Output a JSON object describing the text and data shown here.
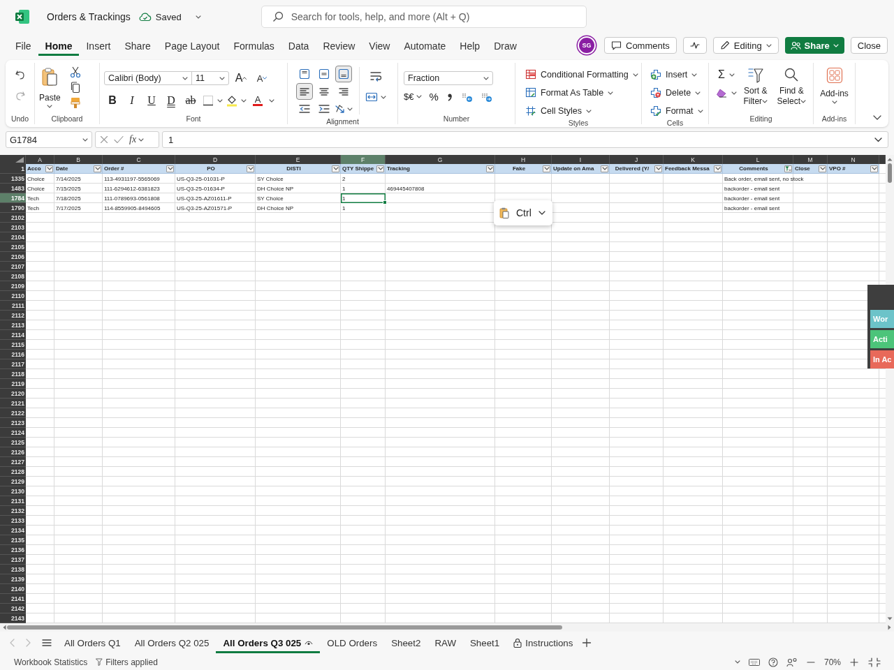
{
  "window": {
    "title": "Orders & Trackings",
    "save_status": "Saved"
  },
  "search": {
    "placeholder": "Search for tools, help, and more (Alt + Q)"
  },
  "menu_tabs": [
    {
      "label": "File",
      "selected": false
    },
    {
      "label": "Home",
      "selected": true
    },
    {
      "label": "Insert",
      "selected": false
    },
    {
      "label": "Share",
      "selected": false
    },
    {
      "label": "Page Layout",
      "selected": false
    },
    {
      "label": "Formulas",
      "selected": false
    },
    {
      "label": "Data",
      "selected": false
    },
    {
      "label": "Review",
      "selected": false
    },
    {
      "label": "View",
      "selected": false
    },
    {
      "label": "Automate",
      "selected": false
    },
    {
      "label": "Help",
      "selected": false
    },
    {
      "label": "Draw",
      "selected": false
    }
  ],
  "account": {
    "initials": "SG"
  },
  "actions": {
    "comments": "Comments",
    "mode": "Editing",
    "share": "Share",
    "close": "Close"
  },
  "ribbon": {
    "undo": {
      "label": "Undo"
    },
    "clipboard": {
      "label": "Clipboard",
      "paste": "Paste"
    },
    "font": {
      "label": "Font",
      "family": "Calibri (Body)",
      "size": "11",
      "grow": "A",
      "shrink": "A",
      "color_label": "A",
      "styles": [
        {
          "kind": "bold",
          "label": "B"
        },
        {
          "kind": "italic",
          "label": "I"
        },
        {
          "kind": "underline",
          "label": "U"
        },
        {
          "kind": "double_underline",
          "label": "D"
        },
        {
          "kind": "strikethrough",
          "label": "ab"
        }
      ]
    },
    "alignment": {
      "label": "Alignment",
      "vertical": [
        {
          "selected": false
        },
        {
          "selected": false
        },
        {
          "selected": true
        }
      ],
      "horizontal": [
        {
          "selected": true
        },
        {
          "selected": false
        },
        {
          "selected": false
        }
      ]
    },
    "number": {
      "label": "Number",
      "format": "Fraction",
      "currency": "$€",
      "percent": "%"
    },
    "styles": {
      "label": "Styles",
      "items": [
        "Conditional Formatting",
        "Format As Table",
        "Cell Styles"
      ]
    },
    "cells": {
      "label": "Cells",
      "items": [
        "Insert",
        "Delete",
        "Format"
      ]
    },
    "editing": {
      "label": "Editing",
      "sum": "Σ",
      "sort": "Sort & Filter",
      "find": "Find & Select"
    },
    "addins": {
      "label": "Add-ins",
      "button": "Add-ins"
    }
  },
  "formula_bar": {
    "name_box": "G1784",
    "function_label": "fx",
    "formula": "1"
  },
  "grid": {
    "columns": [
      {
        "letter": "A",
        "selected": false
      },
      {
        "letter": "B",
        "selected": false
      },
      {
        "letter": "C",
        "selected": false
      },
      {
        "letter": "D",
        "selected": false
      },
      {
        "letter": "E",
        "selected": false
      },
      {
        "letter": "F",
        "selected": true
      },
      {
        "letter": "G",
        "selected": false
      },
      {
        "letter": "H",
        "selected": false
      },
      {
        "letter": "I",
        "selected": false
      },
      {
        "letter": "J",
        "selected": false
      },
      {
        "letter": "K",
        "selected": false
      },
      {
        "letter": "L",
        "selected": false
      },
      {
        "letter": "M",
        "selected": false
      },
      {
        "letter": "N",
        "selected": false
      }
    ],
    "header_row": {
      "number": "1",
      "cells": [
        {
          "label": "Acco",
          "filtered": false
        },
        {
          "label": "Date",
          "filtered": false
        },
        {
          "label": "Order #",
          "filtered": false
        },
        {
          "label": "PO",
          "filtered": false
        },
        {
          "label": "DISTI",
          "filtered": false
        },
        {
          "label": "QTY Shippe",
          "filtered": false
        },
        {
          "label": "Tracking",
          "filtered": false
        },
        {
          "label": "Fake",
          "filtered": false
        },
        {
          "label": "Update on Ama",
          "filtered": false
        },
        {
          "label": "Delivered (Y/",
          "filtered": false
        },
        {
          "label": "Feedback Messa",
          "filtered": false
        },
        {
          "label": "Comments",
          "filtered": true
        },
        {
          "label": "Close",
          "filtered": false
        },
        {
          "label": "VPO #",
          "filtered": false
        }
      ]
    },
    "rows": [
      {
        "number": "1335",
        "selected": false,
        "cells": {
          "A": "Choice",
          "B": "7/14/2025",
          "C": "113-4931197-5565069",
          "D": "US-Q3-25-01031-P",
          "E": "SY Choice",
          "F": "2",
          "L": "Back order, email sent, no stock"
        }
      },
      {
        "number": "1483",
        "selected": false,
        "cells": {
          "A": "Choice",
          "B": "7/15/2025",
          "C": "111-6294612-6381823",
          "D": "US-Q3-25-01634-P",
          "E": "DH Choice NP",
          "F": "1",
          "G": "469445407808",
          "L": "backorder - email sent"
        }
      },
      {
        "number": "1784",
        "selected": true,
        "cells": {
          "A": "Tech",
          "B": "7/18/2025",
          "C": "111-0789693-0561808",
          "D": "US-Q3-25-AZ01611-P",
          "E": "SY Choice",
          "F": "1",
          "L": "backorder - email sent"
        }
      },
      {
        "number": "1790",
        "selected": false,
        "cells": {
          "A": "Tech",
          "B": "7/17/2025",
          "C": "114-8559905-8494605",
          "D": "US-Q3-25-AZ01571-P",
          "E": "DH Choice NP",
          "F": "1",
          "L": "backorder - email sent"
        }
      }
    ],
    "empty_rows": [
      "2102",
      "2103",
      "2104",
      "2105",
      "2106",
      "2107",
      "2108",
      "2109",
      "2110",
      "2111",
      "2112",
      "2113",
      "2114",
      "2115",
      "2116",
      "2117",
      "2118",
      "2119",
      "2120",
      "2121",
      "2122",
      "2123",
      "2124",
      "2125",
      "2126",
      "2127",
      "2128",
      "2129",
      "2130",
      "2131",
      "2132",
      "2133",
      "2134",
      "2135",
      "2136",
      "2137",
      "2138",
      "2139",
      "2140",
      "2141",
      "2142",
      "2143"
    ]
  },
  "paste_options": {
    "label": "Ctrl"
  },
  "side_panel": {
    "items": [
      {
        "label": "Wor",
        "color": "#6cc3c9"
      },
      {
        "label": "Acti",
        "color": "#4cc47a"
      },
      {
        "label": "In Ac",
        "color": "#e8695a"
      }
    ]
  },
  "sheet_tabs": [
    {
      "label": "All Orders Q1",
      "selected": false,
      "kind": "plain"
    },
    {
      "label": "All Orders Q2 025",
      "selected": false,
      "kind": "plain"
    },
    {
      "label": "All Orders Q3 025",
      "selected": true,
      "kind": "watched"
    },
    {
      "label": "OLD Orders",
      "selected": false,
      "kind": "plain"
    },
    {
      "label": "Sheet2",
      "selected": false,
      "kind": "plain"
    },
    {
      "label": "RAW",
      "selected": false,
      "kind": "plain"
    },
    {
      "label": "Sheet1",
      "selected": false,
      "kind": "plain"
    },
    {
      "label": "Instructions",
      "selected": false,
      "kind": "protected"
    }
  ],
  "status_bar": {
    "statistics": "Workbook Statistics",
    "filter_status": "Filters applied",
    "zoom": "70%"
  }
}
